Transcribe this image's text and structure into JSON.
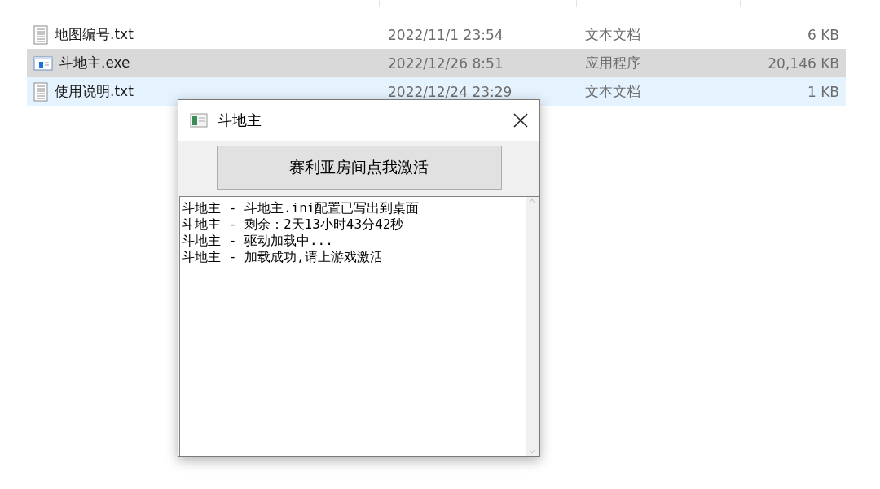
{
  "files": [
    {
      "name": "地图编号.txt",
      "kind": "text",
      "date": "2022/11/1 23:54",
      "type": "文本文档",
      "size": "6 KB",
      "selected": false,
      "hovered": false
    },
    {
      "name": "斗地主.exe",
      "kind": "app",
      "date": "2022/12/26 8:51",
      "type": "应用程序",
      "size": "20,146 KB",
      "selected": true,
      "hovered": false
    },
    {
      "name": "使用说明.txt",
      "kind": "text",
      "date": "2022/12/24 23:29",
      "type": "文本文档",
      "size": "1 KB",
      "selected": false,
      "hovered": true
    }
  ],
  "dialog": {
    "title": "斗地主",
    "button": "赛利亚房间点我激活",
    "log": [
      "斗地主 - 斗地主.ini配置已写出到桌面",
      "斗地主 - 剩余：2天13小时43分42秒",
      "斗地主 - 驱动加载中...",
      "斗地主 - 加载成功,请上游戏激活"
    ]
  }
}
